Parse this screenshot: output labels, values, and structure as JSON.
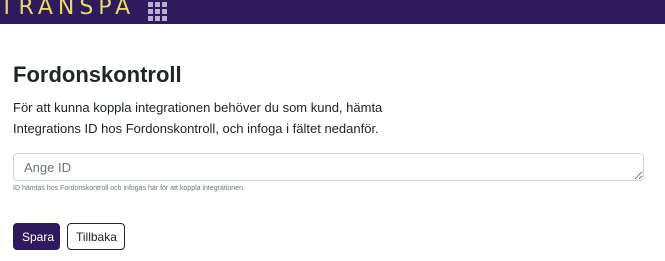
{
  "header": {
    "logo_text": "TRANSPA",
    "menu_icon": "grid-icon"
  },
  "page": {
    "title": "Fordonskontroll",
    "description": "För att kunna koppla integrationen behöver du som kund, hämta Integrations ID hos Fordonskontroll, och infoga i fältet nedanför.",
    "id_field": {
      "placeholder": "Ange ID",
      "value": ""
    },
    "help_text": "ID hämtas hos Fordonskontroll och infogas här för att koppla integrationen.",
    "save_label": "Spara",
    "back_label": "Tillbaka"
  },
  "colors": {
    "brand": "#2d1b5e",
    "logo": "#e8d866"
  }
}
